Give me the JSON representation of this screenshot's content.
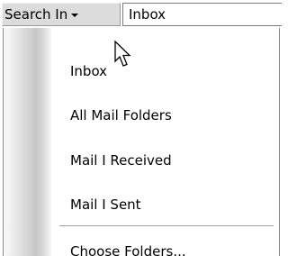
{
  "toolbar": {
    "search_in_label": "Search In",
    "scope_value": "Inbox"
  },
  "menu": {
    "items": [
      {
        "label": "Inbox"
      },
      {
        "label": "All Mail Folders"
      },
      {
        "label": "Mail I Received"
      },
      {
        "label": "Mail I Sent"
      },
      {
        "label": "Choose Folders..."
      }
    ]
  },
  "icons": {
    "dropdown": "chevron-down-icon",
    "cursor": "mouse-pointer-icon"
  },
  "colors": {
    "button_face": "#dcdcdc",
    "menu_background": "#ffffff",
    "separator": "#a0a0a0"
  }
}
